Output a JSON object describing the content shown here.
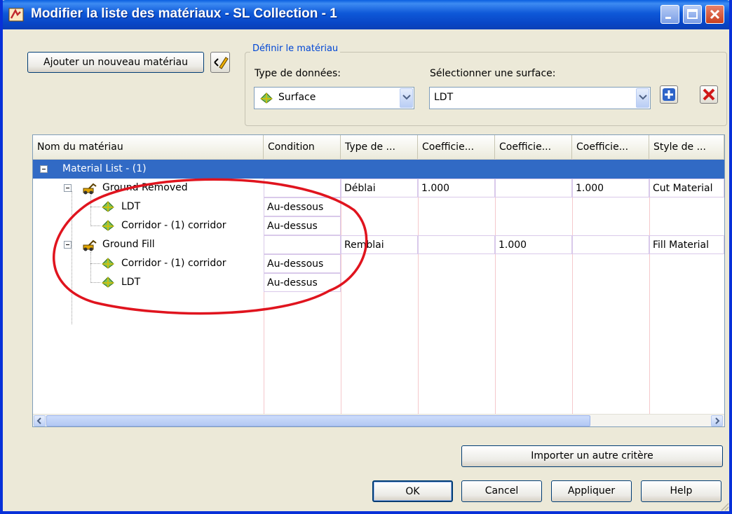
{
  "window": {
    "title": "Modifier la liste des matériaux - SL Collection - 1",
    "icon": "app-icon"
  },
  "toolbar": {
    "add_material_label": "Ajouter un nouveau matériau",
    "edit_icon": "pencil-edit-icon"
  },
  "define_group": {
    "legend": "Définir le matériau",
    "data_type_label": "Type de données:",
    "data_type_value": "Surface",
    "surface_label": "Sélectionner une surface:",
    "surface_value": "LDT",
    "add_icon": "plus-icon",
    "delete_icon": "red-x-icon"
  },
  "table": {
    "columns": [
      "Nom du matériau",
      "Condition",
      "Type de ...",
      "Coefficie...",
      "Coefficie...",
      "Coefficie...",
      "Style de ..."
    ],
    "rows": [
      {
        "name": "Material List - (1)",
        "condition": "",
        "type": "",
        "c1": "",
        "c2": "",
        "c3": "",
        "style": "",
        "level": 0,
        "selected": true
      },
      {
        "name": "Ground Removed",
        "condition": "",
        "type": "Déblai",
        "c1": "1.000",
        "c2": "",
        "c3": "1.000",
        "style": "Cut Material",
        "level": 1
      },
      {
        "name": "LDT",
        "condition": "Au-dessous",
        "type": "",
        "c1": "",
        "c2": "",
        "c3": "",
        "style": "",
        "level": 2
      },
      {
        "name": "Corridor - (1) corridor",
        "condition": "Au-dessus",
        "type": "",
        "c1": "",
        "c2": "",
        "c3": "",
        "style": "",
        "level": 2
      },
      {
        "name": "Ground Fill",
        "condition": "",
        "type": "Remblai",
        "c1": "",
        "c2": "1.000",
        "c3": "",
        "style": "Fill Material",
        "level": 1
      },
      {
        "name": "Corridor - (1) corridor",
        "condition": "Au-dessous",
        "type": "",
        "c1": "",
        "c2": "",
        "c3": "",
        "style": "",
        "level": 2
      },
      {
        "name": "LDT",
        "condition": "Au-dessus",
        "type": "",
        "c1": "",
        "c2": "",
        "c3": "",
        "style": "",
        "level": 2
      }
    ]
  },
  "buttons": {
    "import": "Importer un autre critère",
    "ok": "OK",
    "cancel": "Cancel",
    "apply": "Appliquer",
    "help": "Help"
  },
  "colors": {
    "titlebar": "#0a54d6",
    "selection": "#316ac5",
    "annotation": "#e0141e"
  }
}
